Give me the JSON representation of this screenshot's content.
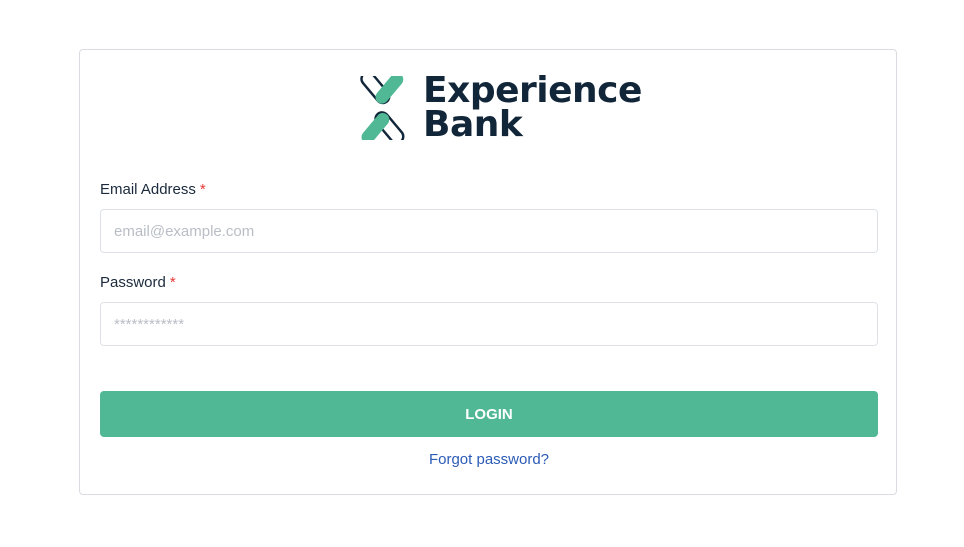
{
  "brand": {
    "line1": "Experience",
    "line2": "Bank",
    "text_color": "#12263a",
    "accent_color": "#50b894"
  },
  "form": {
    "email": {
      "label": "Email Address",
      "required_marker": "*",
      "placeholder": "email@example.com",
      "value": ""
    },
    "password": {
      "label": "Password",
      "required_marker": "*",
      "placeholder": "************",
      "value": ""
    },
    "login_label": "LOGIN",
    "forgot_label": "Forgot password?"
  }
}
